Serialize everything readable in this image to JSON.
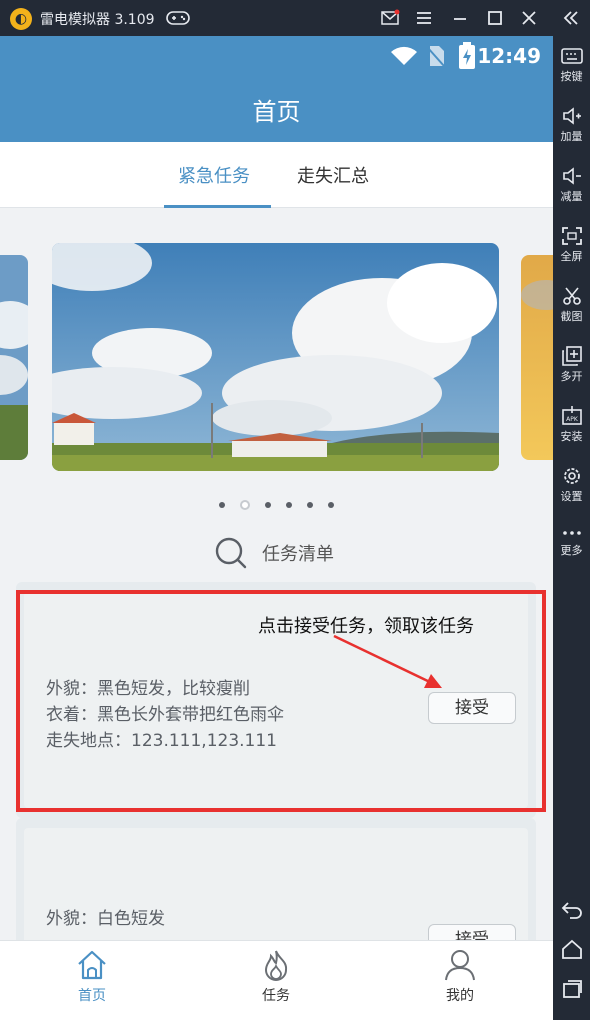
{
  "emulator": {
    "title": "雷电模拟器 3.109",
    "sidebar": [
      {
        "label": "按键",
        "icon": "keyboard-icon"
      },
      {
        "label": "加量",
        "icon": "volume-up-icon"
      },
      {
        "label": "减量",
        "icon": "volume-down-icon"
      },
      {
        "label": "全屏",
        "icon": "fullscreen-icon"
      },
      {
        "label": "截图",
        "icon": "scissors-icon"
      },
      {
        "label": "多开",
        "icon": "multi-instance-icon"
      },
      {
        "label": "安装",
        "icon": "apk-install-icon"
      },
      {
        "label": "设置",
        "icon": "gear-icon"
      },
      {
        "label": "更多",
        "icon": "more-icon"
      }
    ]
  },
  "status_bar": {
    "time": "12:49"
  },
  "header": {
    "title": "首页"
  },
  "tabs": [
    {
      "label": "紧急任务",
      "active": true
    },
    {
      "label": "走失汇总",
      "active": false
    }
  ],
  "carousel": {
    "slide_count": 6,
    "active_index": 1
  },
  "task_list": {
    "title": "任务清单"
  },
  "tasks": [
    {
      "lines": [
        "外貌：黑色短发，比较瘦削",
        "衣着：黑色长外套带把红色雨伞",
        "走失地点：123.111,123.111"
      ],
      "accept_label": "接受"
    },
    {
      "lines": [
        "外貌：白色短发"
      ],
      "accept_label": "接受"
    }
  ],
  "annotation": {
    "text": "点击接受任务，领取该任务",
    "color": "#e8312f"
  },
  "bottom_nav": [
    {
      "label": "首页",
      "icon": "home-icon",
      "active": true
    },
    {
      "label": "任务",
      "icon": "fire-icon",
      "active": false
    },
    {
      "label": "我的",
      "icon": "person-icon",
      "active": false
    }
  ],
  "colors": {
    "accent": "#4a90c4",
    "annotation": "#e8312f"
  }
}
